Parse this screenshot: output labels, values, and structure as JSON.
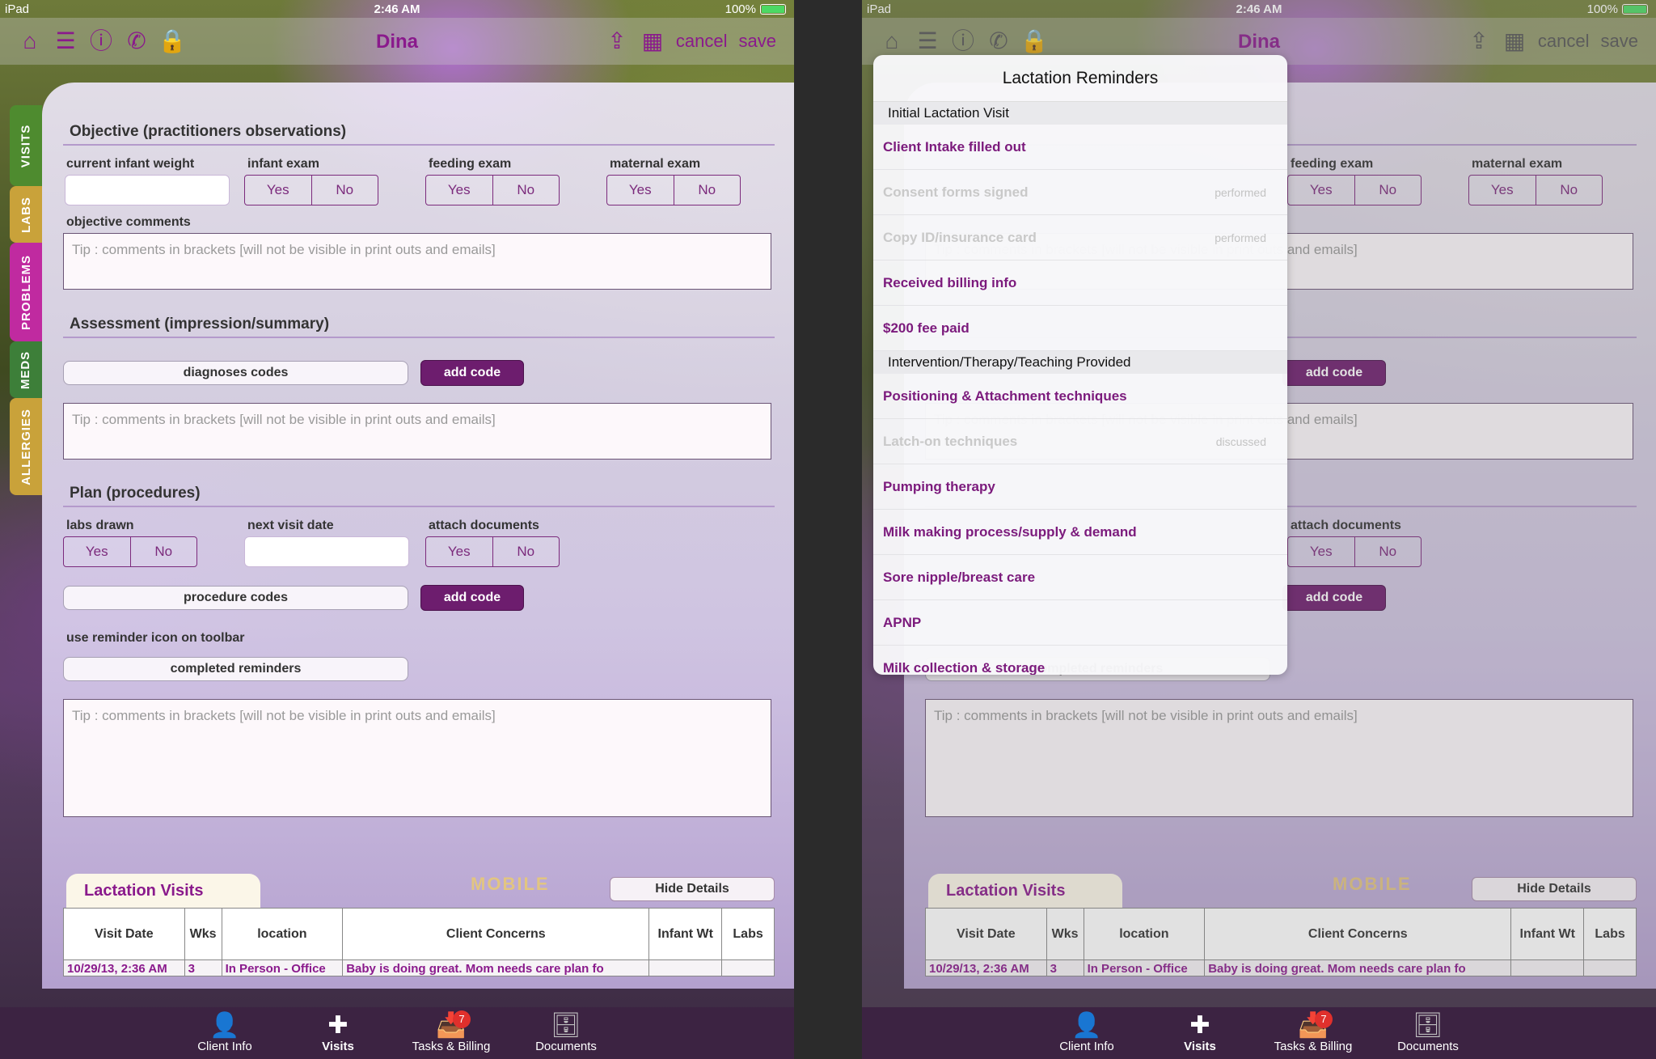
{
  "statusbar": {
    "carrier": "iPad",
    "time": "2:46 AM",
    "battery": "100%"
  },
  "navbar": {
    "title": "Dina",
    "cancel_label": "cancel",
    "save_label": "save"
  },
  "sidetabs": [
    "VISITS",
    "LABS",
    "PROBLEMS",
    "MEDS",
    "ALLERGIES"
  ],
  "objective": {
    "title": "Objective (practitioners observations)",
    "current_infant_weight_label": "current infant weight",
    "infant_exam_label": "infant exam",
    "feeding_exam_label": "feeding exam",
    "maternal_exam_label": "maternal exam",
    "yes": "Yes",
    "no": "No",
    "comments_label": "objective comments",
    "tip": "Tip : comments in brackets [will not be visible in print outs and emails]"
  },
  "assessment": {
    "title": "Assessment (impression/summary)",
    "diagnoses_label": "diagnoses codes",
    "add_code_label": "add code",
    "tip": "Tip : comments in brackets [will not be visible in print outs and emails]"
  },
  "plan": {
    "title": "Plan (procedures)",
    "labs_drawn_label": "labs drawn",
    "next_visit_label": "next visit date",
    "attach_documents_label": "attach documents",
    "procedure_codes_label": "procedure codes",
    "add_code_label": "add code",
    "reminder_hint": "use reminder icon on toolbar",
    "completed_reminders_label": "completed reminders",
    "tip": "Tip : comments in brackets [will not be visible in print outs and emails]"
  },
  "visits": {
    "title": "Lactation Visits",
    "hide_details_label": "Hide Details",
    "brand": "MOBILE",
    "columns": [
      "Visit Date",
      "Wks",
      "location",
      "Client Concerns",
      "Infant Wt",
      "Labs"
    ],
    "row": [
      "10/29/13, 2:36 AM",
      "3",
      "In Person - Office",
      "Baby is doing great. Mom needs care plan fo",
      "",
      ""
    ]
  },
  "tabbar": {
    "items": [
      {
        "label": "Client Info",
        "icon": "person-icon"
      },
      {
        "label": "Visits",
        "icon": "medkit-icon"
      },
      {
        "label": "Tasks & Billing",
        "icon": "inbox-icon",
        "badge": "7"
      },
      {
        "label": "Documents",
        "icon": "cabinet-icon"
      }
    ]
  },
  "popover": {
    "title": "Lactation Reminders",
    "sections": [
      {
        "header": "Initial Lactation Visit",
        "items": [
          {
            "label": "Client Intake filled out",
            "status": ""
          },
          {
            "label": "Consent forms signed",
            "status": "performed"
          },
          {
            "label": "Copy ID/insurance card",
            "status": "performed"
          },
          {
            "label": "Received billing info",
            "status": ""
          },
          {
            "label": "$200 fee paid",
            "status": ""
          }
        ]
      },
      {
        "header": "Intervention/Therapy/Teaching Provided",
        "items": [
          {
            "label": "Positioning & Attachment techniques",
            "status": ""
          },
          {
            "label": "Latch-on techniques",
            "status": "discussed"
          },
          {
            "label": "Pumping therapy",
            "status": ""
          },
          {
            "label": "Milk making process/supply & demand",
            "status": ""
          },
          {
            "label": "Sore nipple/breast care",
            "status": ""
          },
          {
            "label": "APNP",
            "status": ""
          },
          {
            "label": "Milk collection & storage",
            "status": ""
          }
        ]
      }
    ]
  },
  "colors": {
    "accent": "#8a1a8c",
    "button": "#6d1d6e",
    "tabbar": "#3c2342"
  }
}
